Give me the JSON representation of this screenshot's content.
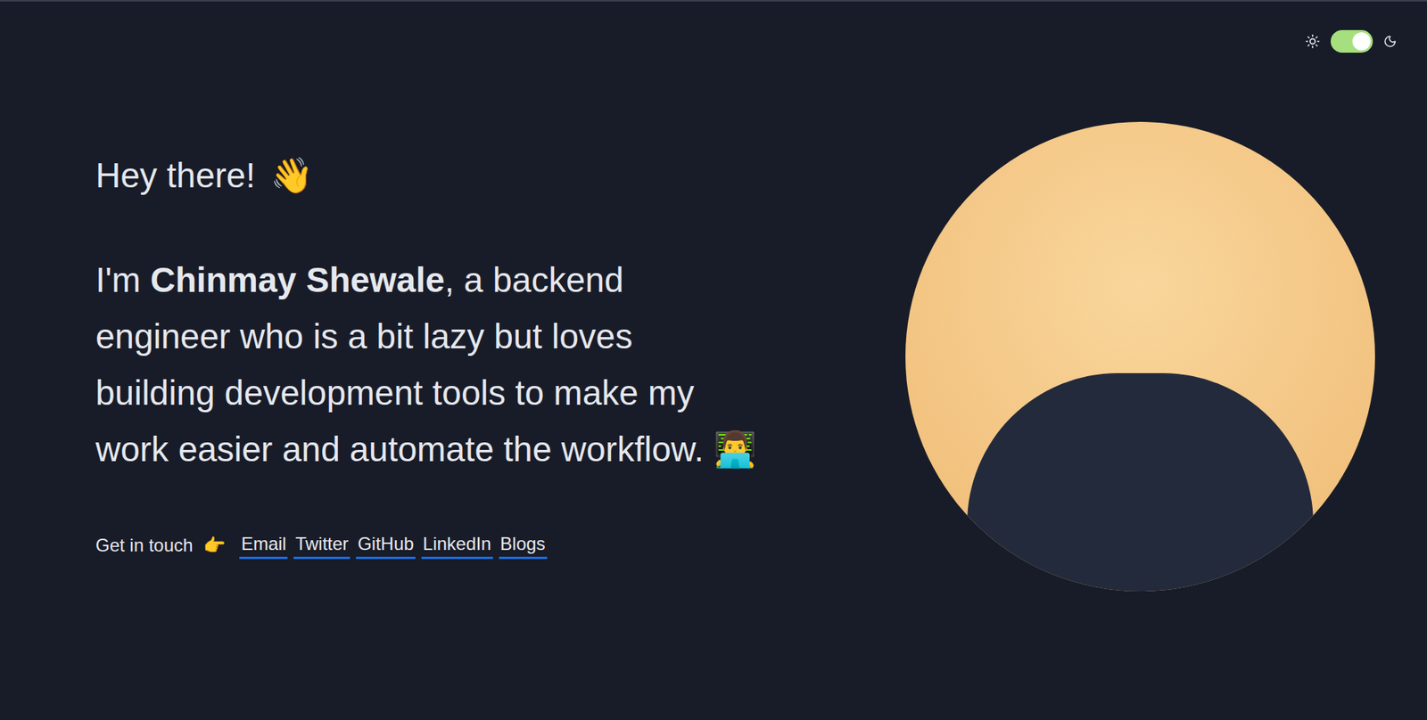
{
  "theme_toggle": {
    "on": true
  },
  "greeting": {
    "text": "Hey there!",
    "emoji": "👋"
  },
  "intro": {
    "prefix": "I'm ",
    "name": "Chinmay Shewale",
    "suffix": ", a backend engineer who is a bit lazy but loves building development tools to make my work easier and automate the workflow.",
    "emoji": "👨‍💻"
  },
  "contact": {
    "label": "Get in touch",
    "emoji": "👉",
    "links": [
      "Email",
      "Twitter",
      "GitHub",
      "LinkedIn",
      "Blogs"
    ]
  },
  "photo": {
    "alt": "Chinmay Shewale"
  }
}
